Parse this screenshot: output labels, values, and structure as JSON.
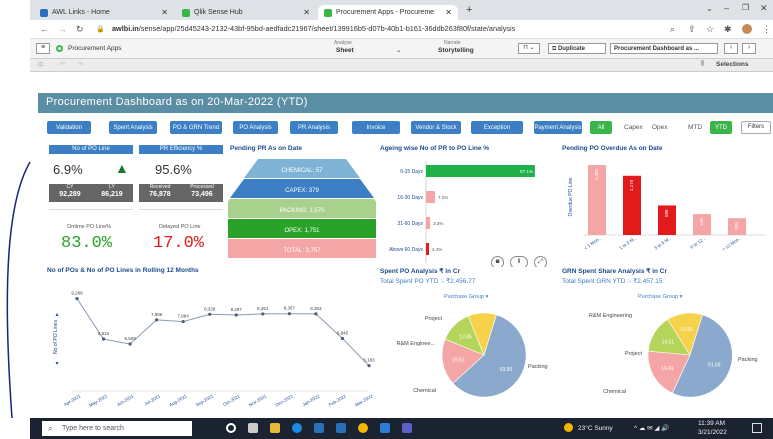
{
  "browser": {
    "tabs": [
      {
        "label": "AWL Links - Home",
        "color": "#2a6fbd"
      },
      {
        "label": "Qlik Sense Hub",
        "color": "#3bb54a"
      },
      {
        "label": "Procurement Apps - Procureme",
        "color": "#3bb54a"
      }
    ],
    "url_host": "awlbi.in",
    "url_path": "/sense/app/25d45243-2132-43bf-95bd-aedfadc21967/sheet/139916b5-d07b-40b1-b161-36ddb263f80f/state/analysis"
  },
  "qlik": {
    "app_name": "Procurement Apps",
    "analyse_label": "Analyse",
    "sheet_label": "Sheet",
    "narrate_label": "Narrate",
    "storytelling_label": "Storytelling",
    "duplicate_label": "Duplicate",
    "sheet_name": "Procurement Dashboard as ...",
    "selections_label": "Selections"
  },
  "dashboard": {
    "title": "Procurement Dashboard as on 20-Mar-2022 (YTD)",
    "filters": [
      "Validation",
      "Spent Analysis",
      "PO & GRN Trend",
      "PO Analysis",
      "PR Analysis",
      "Invoice",
      "Vendor & Stock",
      "Exception",
      "Payment Analysis"
    ],
    "toggle_all": "All",
    "toggle_capex": "Capex",
    "toggle_opex": "Opex",
    "toggle_mtd": "MTD",
    "toggle_ytd": "YTD",
    "filters_label": "Filters"
  },
  "kpi": {
    "po_line_title": "No of PO Line",
    "po_line_value": "6.9%",
    "po_line_up": "▲",
    "cy_label": "CY",
    "cy_value": "92,289",
    "ly_label": "LY",
    "ly_value": "86,219",
    "pr_eff_title": "PR Efficiency %",
    "pr_eff_value": "95.6%",
    "received_label": "Received",
    "received_value": "76,878",
    "processed_label": "Processed",
    "processed_value": "73,496",
    "ontime_label": "Ontime PO Line%",
    "ontime_value": "83.0%",
    "delayed_label": "Delayed PO Line",
    "delayed_value": "17.0%"
  },
  "pending_pr": {
    "title": "Pending PR As on Date",
    "levels": [
      {
        "label": "CHEMICAL: 57",
        "color": "#7fb3d5"
      },
      {
        "label": "CAPEX: 379",
        "color": "#3c7fc4"
      },
      {
        "label": "PACKING: 1,570",
        "color": "#a9d18e"
      },
      {
        "label": "OPEX: 1,751",
        "color": "#2aa22a"
      },
      {
        "label": "TOTAL: 3,757",
        "color": "#f4a6a6"
      }
    ]
  },
  "ageing": {
    "title": "Ageing wise No of PR to PO Line %",
    "rows": [
      {
        "label": "0-15 Days",
        "pct": 87.1,
        "text": "87.1%",
        "color": "#1fb04a"
      },
      {
        "label": "16-30 Days",
        "pct": 7.2,
        "text": "7.2%",
        "color": "#f4a6a6"
      },
      {
        "label": "31-60 Days",
        "pct": 3.3,
        "text": "3.3%",
        "color": "#f4a6a6"
      },
      {
        "label": "Above 60 Days",
        "pct": 2.4,
        "text": "2.4%",
        "color": "#e31a1c"
      }
    ]
  },
  "pending_po": {
    "title": "Pending PO Overdue As on Date",
    "ylabel": "Overdue PO Line",
    "bars": [
      {
        "cat": "< 1 Mon..",
        "value": 1392,
        "label": "1,392",
        "color": "#f4a6a6"
      },
      {
        "cat": "1 to 3 M..",
        "value": 1178,
        "label": "1,178",
        "color": "#e31a1c"
      },
      {
        "cat": "3 to 6 M..",
        "value": 588,
        "label": "588",
        "color": "#e31a1c"
      },
      {
        "cat": "6 to 12 ..",
        "value": 416,
        "label": "416",
        "color": "#f4a6a6"
      },
      {
        "cat": "> 12 Mon..",
        "value": 335,
        "label": "335",
        "color": "#f4a6a6"
      }
    ]
  },
  "chart_data": [
    {
      "type": "line",
      "title": "No of POs & No of PO Lines in Rolling 12 Months",
      "ylabel": "No of PO Lines",
      "categories": [
        "Apr-2021",
        "May-2021",
        "Jun-2021",
        "Jul-2021",
        "Aug-2021",
        "Sep-2021",
        "Oct-2021",
        "Nov-2021",
        "Dec-2021",
        "Jan-2022",
        "Feb-2022",
        "Mar-2022"
      ],
      "values": [
        9289,
        6815,
        6509,
        7986,
        7884,
        8328,
        8287,
        8351,
        8367,
        8353,
        6845,
        5183
      ],
      "labels": [
        "9,289",
        "6,815",
        "6,509",
        "7,986",
        "7,884",
        "8,328",
        "8,287",
        "8,351",
        "8,367",
        "8,353",
        "6,845",
        "5,183"
      ],
      "ylim": [
        4000,
        10000
      ]
    },
    {
      "type": "pie",
      "title": "Spent PO Analysis ₹ in Cr",
      "subtitle": "Total Spent PO YTD :- ₹2,456.77",
      "dropdown": "Purchase Group",
      "slices": [
        {
          "name": "Packing",
          "value": 63.95,
          "label": "63.95",
          "color": "#8aa9cc"
        },
        {
          "name": "Chemical",
          "value": 19.61,
          "label": "19.61",
          "color": "#f4a6a6"
        },
        {
          "name": "R&M Enginee...",
          "value": 13.85,
          "label": "13.85",
          "color": "#b5d55a"
        },
        {
          "name": "Project",
          "value": 12.0,
          "label": "",
          "color": "#f6d24a"
        }
      ]
    },
    {
      "type": "pie",
      "title": "GRN Spent Share Analysis ₹ in Cr",
      "subtitle": "Total Spent GRN YTD :- ₹2,457.15",
      "dropdown": "Purchase Group",
      "slices": [
        {
          "name": "Packing",
          "value": 51.66,
          "label": "51.66",
          "color": "#8aa9cc"
        },
        {
          "name": "Chemical",
          "value": 19.41,
          "label": "19.41",
          "color": "#f4a6a6"
        },
        {
          "name": "Project",
          "value": 14.51,
          "label": "14.51",
          "color": "#b5d55a"
        },
        {
          "name": "R&M Engineering",
          "value": 13.55,
          "label": "13.55",
          "color": "#f6d24a"
        }
      ]
    }
  ],
  "taskbar": {
    "search_placeholder": "Type here to search",
    "weather": "23°C  Sunny",
    "time": "11:39 AM",
    "date": "3/21/2022"
  }
}
